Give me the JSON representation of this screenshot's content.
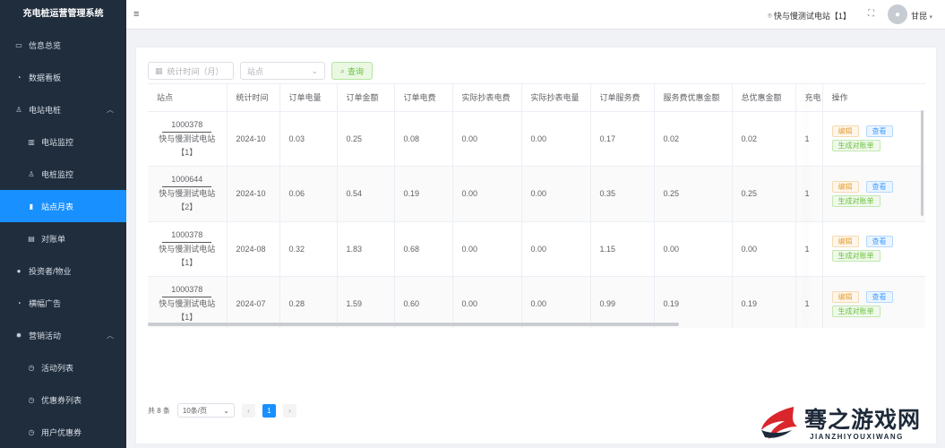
{
  "app": {
    "title": "充电桩运营管理系统"
  },
  "sidebar": {
    "items": [
      {
        "label": "信息总览",
        "icon": "monitor-icon"
      },
      {
        "label": "数据看板",
        "icon": "dashboard-icon"
      },
      {
        "label": "电站电桩",
        "icon": "user-icon"
      },
      {
        "label": "电站监控",
        "icon": "building-icon"
      },
      {
        "label": "电桩监控",
        "icon": "user-icon"
      },
      {
        "label": "站点月表",
        "icon": "bar-chart-icon"
      },
      {
        "label": "对账单",
        "icon": "wallet-icon"
      },
      {
        "label": "投资者/物业",
        "icon": "person-icon"
      },
      {
        "label": "横幅广告",
        "icon": "dashboard-icon"
      },
      {
        "label": "营销活动",
        "icon": "gear-icon"
      },
      {
        "label": "活动列表",
        "icon": "clock-icon"
      },
      {
        "label": "优惠券列表",
        "icon": "clock-icon"
      },
      {
        "label": "用户优惠券",
        "icon": "clock-icon"
      }
    ]
  },
  "header": {
    "station": "快与慢测试电站【1】",
    "username": "甘昆"
  },
  "filters": {
    "date_placeholder": "统计时间（月）",
    "site_placeholder": "站点",
    "query_label": "查询"
  },
  "table": {
    "columns": [
      "站点",
      "统计时间",
      "订单电量",
      "订单金额",
      "订单电费",
      "实际抄表电费",
      "实际抄表电量",
      "订单服务费",
      "服务费优惠金额",
      "总优惠金额",
      "充电",
      "操作"
    ],
    "rows": [
      {
        "site_code": "1000378",
        "site_name": "快与慢测试电站",
        "site_no": "【1】",
        "month": "2024-10",
        "kwh": "0.03",
        "amount": "0.25",
        "elec_fee": "0.08",
        "meter_fee": "0.00",
        "meter_kwh": "0.00",
        "service_fee": "0.17",
        "service_discount": "0.02",
        "total_discount": "0.02",
        "count": "1"
      },
      {
        "site_code": "1000644",
        "site_name": "快与慢测试电站",
        "site_no": "【2】",
        "month": "2024-10",
        "kwh": "0.06",
        "amount": "0.54",
        "elec_fee": "0.19",
        "meter_fee": "0.00",
        "meter_kwh": "0.00",
        "service_fee": "0.35",
        "service_discount": "0.25",
        "total_discount": "0.25",
        "count": "1"
      },
      {
        "site_code": "1000378",
        "site_name": "快与慢测试电站",
        "site_no": "【1】",
        "month": "2024-08",
        "kwh": "0.32",
        "amount": "1.83",
        "elec_fee": "0.68",
        "meter_fee": "0.00",
        "meter_kwh": "0.00",
        "service_fee": "1.15",
        "service_discount": "0.00",
        "total_discount": "0.00",
        "count": "1"
      },
      {
        "site_code": "1000378",
        "site_name": "快与慢测试电站",
        "site_no": "【1】",
        "month": "2024-07",
        "kwh": "0.28",
        "amount": "1.59",
        "elec_fee": "0.60",
        "meter_fee": "0.00",
        "meter_kwh": "0.00",
        "service_fee": "0.99",
        "service_discount": "0.19",
        "total_discount": "0.19",
        "count": "1"
      }
    ],
    "actions": {
      "edit": "编辑",
      "view": "查看",
      "bill": "生成对账单"
    }
  },
  "pagination": {
    "total": "共 8 条",
    "page_size": "10条/页",
    "current_page": "1"
  },
  "watermark": {
    "title": "骞之游戏网",
    "subtitle": "JIANZHIYOUXIWANG"
  },
  "colors": {
    "sidebar_bg": "#1f2d3d",
    "active": "#1890ff",
    "edit": "#e6a23c",
    "view": "#409eff",
    "bill": "#67c23a"
  }
}
